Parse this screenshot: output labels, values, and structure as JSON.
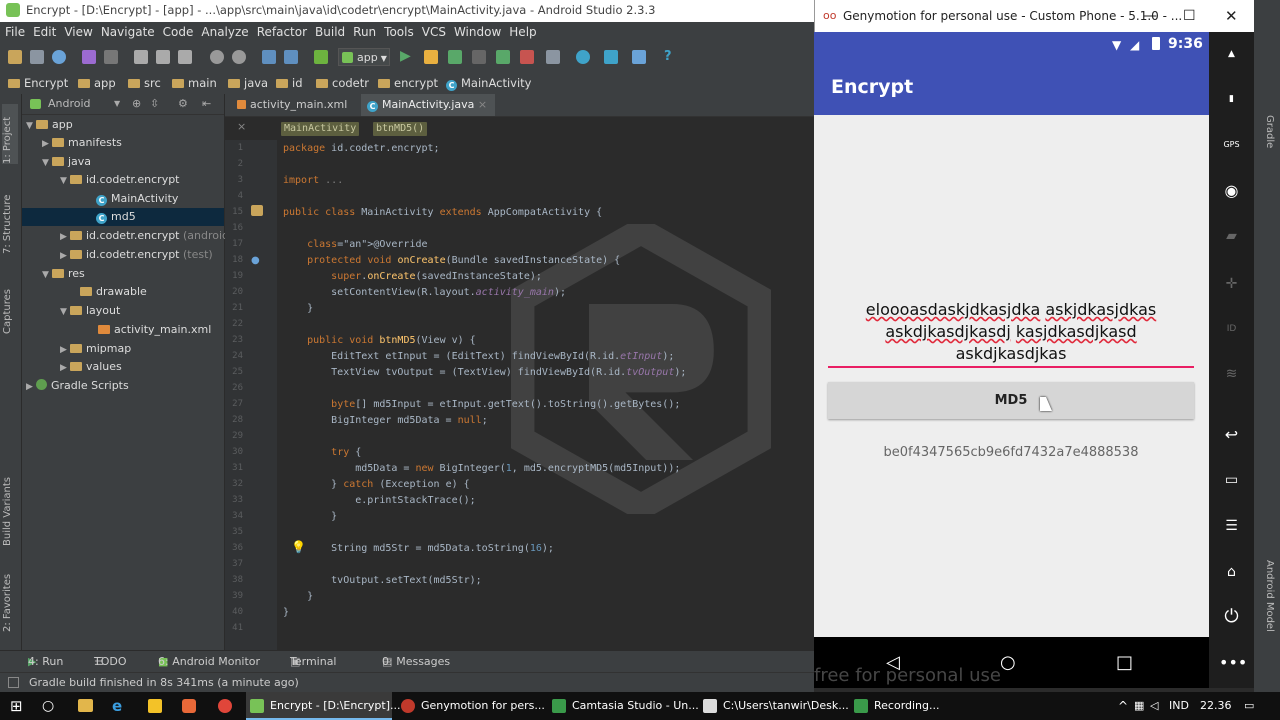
{
  "as_window": {
    "title": "Encrypt - [D:\\Encrypt] - [app] - ...\\app\\src\\main\\java\\id\\codetr\\encrypt\\MainActivity.java - Android Studio 2.3.3"
  },
  "menu": [
    "File",
    "Edit",
    "View",
    "Navigate",
    "Code",
    "Analyze",
    "Refactor",
    "Build",
    "Run",
    "Tools",
    "VCS",
    "Window",
    "Help"
  ],
  "toolbar": {
    "run_config": "app"
  },
  "breadcrumb": [
    "Encrypt",
    "app",
    "src",
    "main",
    "java",
    "id",
    "codetr",
    "encrypt",
    "MainActivity"
  ],
  "left_strip": {
    "project": "1: Project",
    "structure": "7: Structure",
    "captures": "Captures",
    "build_variants": "Build Variants",
    "favorites": "2: Favorites"
  },
  "project_panel": {
    "view_mode": "Android",
    "tree": [
      {
        "label": "app",
        "kind": "folder"
      },
      {
        "label": "manifests",
        "kind": "folder"
      },
      {
        "label": "java",
        "kind": "folder"
      },
      {
        "label": "id.codetr.encrypt",
        "kind": "folder"
      },
      {
        "label": "MainActivity",
        "kind": "class"
      },
      {
        "label": "md5",
        "kind": "class"
      },
      {
        "label": "id.codetr.encrypt",
        "hint": "(androidTest)",
        "kind": "folder"
      },
      {
        "label": "id.codetr.encrypt",
        "hint": "(test)",
        "kind": "folder"
      },
      {
        "label": "res",
        "kind": "folder"
      },
      {
        "label": "drawable",
        "kind": "folder"
      },
      {
        "label": "layout",
        "kind": "folder"
      },
      {
        "label": "activity_main.xml",
        "kind": "xml"
      },
      {
        "label": "mipmap",
        "kind": "folder"
      },
      {
        "label": "values",
        "kind": "folder"
      },
      {
        "label": "Gradle Scripts",
        "kind": "gradle"
      }
    ]
  },
  "editor": {
    "tabs": [
      "activity_main.xml",
      "MainActivity.java"
    ],
    "crumbs": [
      "MainActivity",
      "btnMD5()"
    ],
    "line_numbers": [
      "1",
      "2",
      "3",
      "4",
      "15",
      "16",
      "17",
      "18",
      "19",
      "20",
      "21",
      "22",
      "23",
      "24",
      "25",
      "26",
      "27",
      "28",
      "29",
      "30",
      "31",
      "32",
      "33",
      "34",
      "35",
      "36",
      "37",
      "38",
      "39",
      "40",
      "41"
    ],
    "code": [
      "package id.codetr.encrypt;",
      "",
      "import ...",
      "",
      "public class MainActivity extends AppCompatActivity {",
      "",
      "    @Override",
      "    protected void onCreate(Bundle savedInstanceState) {",
      "        super.onCreate(savedInstanceState);",
      "        setContentView(R.layout.activity_main);",
      "    }",
      "",
      "    public void btnMD5(View v) {",
      "        EditText etInput = (EditText) findViewById(R.id.etInput);",
      "        TextView tvOutput = (TextView) findViewById(R.id.tvOutput);",
      "",
      "        byte[] md5Input = etInput.getText().toString().getBytes();",
      "        BigInteger md5Data = null;",
      "",
      "        try {",
      "            md5Data = new BigInteger(1, md5.encryptMD5(md5Input));",
      "        } catch (Exception e) {",
      "            e.printStackTrace();",
      "        }",
      "",
      "        String md5Str = md5Data.toString(16);",
      "",
      "        tvOutput.setText(md5Str);",
      "    }",
      "}",
      ""
    ]
  },
  "bottom_tools": [
    "4: Run",
    "TODO",
    "6: Android Monitor",
    "Terminal",
    "0: Messages"
  ],
  "status_bar": {
    "message": "Gradle build finished in 8s 341ms (a minute ago)"
  },
  "genymotion": {
    "title": "Genymotion for personal use - Custom Phone - 5.1.0 - ...",
    "watermark": "free for personal use",
    "side_buttons": [
      "gapps-icon",
      "battery-icon",
      "gps-icon",
      "camera-icon",
      "capture-icon",
      "dpad-icon",
      "id-icon",
      "network-icon",
      "back-icon",
      "recent-icon",
      "menu-icon",
      "home-icon",
      "power-icon"
    ]
  },
  "phone": {
    "time": "9:36",
    "app_title": "Encrypt",
    "input_text": "eloooasdaskjdkasjdka askjdkasjdkas askdjkasdjkasdj kasjdkasdjkasd askdjkasdjkas",
    "input_lines": [
      [
        {
          "t": "eloooasdaskjdkasjdka",
          "sq": true
        },
        {
          "t": " ",
          "sq": false
        },
        {
          "t": "askjdkasjdkas",
          "sq": true
        }
      ],
      [
        {
          "t": "askdjkasdjkasdj",
          "sq": true
        },
        {
          "t": " ",
          "sq": false
        },
        {
          "t": "kasjdkasdjkasd",
          "sq": true
        }
      ],
      [
        {
          "t": "askdjkasdjkas",
          "sq": false
        }
      ]
    ],
    "button_label": "MD5",
    "output": "be0f4347565cb9e6fd7432a7e4888538"
  },
  "taskbar": {
    "tasks": [
      "Encrypt - [D:\\Encrypt]...",
      "Genymotion for pers...",
      "Camtasia Studio - Un...",
      "C:\\Users\\tanwir\\Desk...",
      "Recording..."
    ],
    "language": "IND",
    "time": "22.36"
  },
  "right_strip": {
    "top": "Gradle",
    "bottom": "Android Model"
  },
  "colors": {
    "app_bar": "#3f51b5",
    "accent": "#e91e63",
    "keyword": "#cc7832",
    "method": "#ffc66d"
  }
}
